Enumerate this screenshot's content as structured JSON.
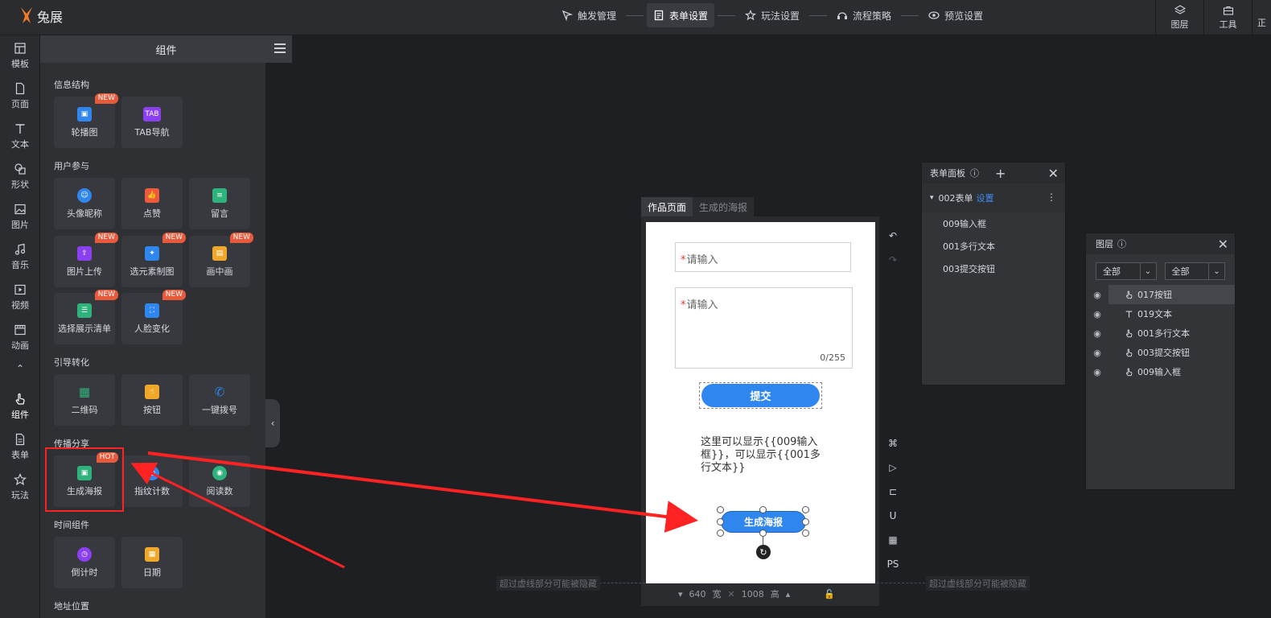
{
  "app": {
    "name": "兔展"
  },
  "steps": [
    {
      "label": "触发管理",
      "icon": "trigger-icon",
      "active": false
    },
    {
      "label": "表单设置",
      "icon": "form-icon",
      "active": true
    },
    {
      "label": "玩法设置",
      "icon": "star-icon",
      "active": false
    },
    {
      "label": "流程策略",
      "icon": "flow-icon",
      "active": false
    },
    {
      "label": "预览设置",
      "icon": "eye-icon",
      "active": false
    }
  ],
  "top_right": {
    "layers": "图层",
    "tools": "工具",
    "cut": "正"
  },
  "rail": {
    "items": [
      {
        "label": "模板",
        "icon": "template-icon"
      },
      {
        "label": "页面",
        "icon": "page-icon"
      },
      {
        "label": "文本",
        "icon": "text-icon"
      },
      {
        "label": "形状",
        "icon": "shape-icon"
      },
      {
        "label": "图片",
        "icon": "image-icon"
      },
      {
        "label": "音乐",
        "icon": "music-icon"
      },
      {
        "label": "视频",
        "icon": "video-icon"
      },
      {
        "label": "动画",
        "icon": "animation-icon"
      }
    ],
    "collapse": "«",
    "lower": [
      {
        "label": "组件",
        "icon": "hand-icon",
        "active": true
      },
      {
        "label": "表单",
        "icon": "form-icon"
      },
      {
        "label": "玩法",
        "icon": "star-icon"
      }
    ]
  },
  "panel": {
    "title": "组件",
    "sections": {
      "info": "信息结构",
      "user": "用户参与",
      "guide": "引导转化",
      "share": "传播分享",
      "time": "时间组件",
      "location": "地址位置"
    },
    "tiles": {
      "carousel": "轮播图",
      "tabnav": "TAB导航",
      "avatar": "头像昵称",
      "like": "点赞",
      "comment": "留言",
      "upload": "图片上传",
      "element": "选元素制图",
      "pip": "画中画",
      "list": "选择展示清单",
      "face": "人脸变化",
      "qr": "二维码",
      "button": "按钮",
      "dial": "一键拨号",
      "poster": "生成海报",
      "finger": "指纹计数",
      "reads": "阅读数",
      "countdown": "倒计时",
      "date": "日期"
    },
    "badges": {
      "new": "NEW",
      "hot": "HOT"
    },
    "tab_icon_text": "TAB"
  },
  "canvas": {
    "tabs": [
      "作品页面",
      "生成的海报"
    ],
    "input_placeholder": "请输入",
    "textarea_placeholder": "请输入",
    "required_mark": "*",
    "counter": "0/255",
    "submit": "提交",
    "text_line1": "这里可以显示{{009输入",
    "text_line2": "框}}，可以显示{{001多",
    "text_line3": "行文本}}",
    "poster_button": "生成海报",
    "note": "超过虚线部分可能被隐藏",
    "width": "640",
    "width_label": "宽",
    "height": "1008",
    "height_label": "高",
    "ps": "PS"
  },
  "form_panel": {
    "title": "表单面板",
    "group": "002表单",
    "settings_link": "设置",
    "items": [
      "009输入框",
      "001多行文本",
      "003提交按钮"
    ]
  },
  "layer_panel": {
    "title": "图层",
    "filter1": "全部",
    "filter2": "全部",
    "items": [
      {
        "name": "017按钮",
        "type": "hand"
      },
      {
        "name": "019文本",
        "type": "text"
      },
      {
        "name": "001多行文本",
        "type": "hand"
      },
      {
        "name": "003提交按钮",
        "type": "hand"
      },
      {
        "name": "009输入框",
        "type": "hand"
      }
    ]
  },
  "colors": {
    "accent": "#2f86ee",
    "badge": "#e85a3c",
    "annotation": "#ff2222"
  }
}
